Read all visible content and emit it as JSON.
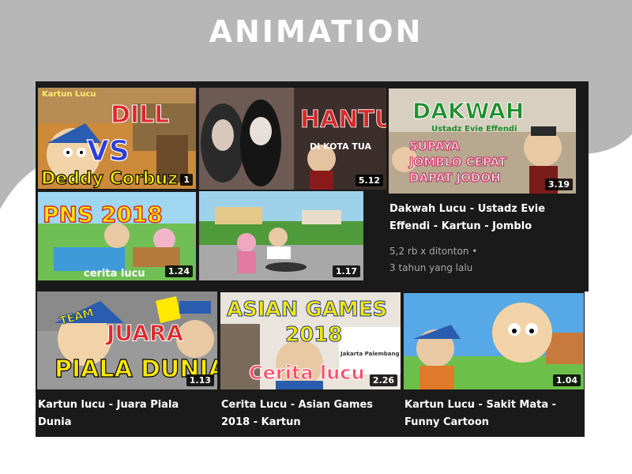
{
  "page": {
    "heading": "ANIMATION"
  },
  "colors": {
    "background_grey": "#b7b7b7",
    "panel": "#1a1a1a",
    "title_text": "#ffffff",
    "meta_text": "#a8a8a8"
  },
  "videos": [
    {
      "thumb_text": [
        "Kartun Lucu",
        "DILL",
        "VS",
        "Deddy Corbuz"
      ],
      "duration": "1"
    },
    {
      "thumb_text": [
        "HANTU",
        "DI KOTA TUA"
      ],
      "duration": "5.12"
    },
    {
      "thumb_text": [
        "DAKWAH",
        "Ustadz Evie Effendi",
        "SUPAYA",
        "JOMBLO CEPAT",
        "DAPAT JODOH"
      ],
      "duration": "3.19",
      "title_lines": [
        "Dakwah Lucu - Ustadz Evie",
        "Effendi - Kartun - Jomblo"
      ],
      "views": "5,2 rb x ditonton",
      "dot": "•",
      "age": "3 tahun yang lalu"
    },
    {
      "thumb_text": [
        "PNS 2018",
        "cerita lucu"
      ],
      "duration": "1.24"
    },
    {
      "thumb_text": [],
      "duration": "1.17"
    },
    {
      "thumb_text": [
        "TEAM",
        "JUARA",
        "PIALA DUNIA"
      ],
      "duration": "1.13",
      "title_lines": [
        "Kartun lucu - Juara Piala",
        "Dunia"
      ]
    },
    {
      "thumb_text": [
        "ASIAN GAMES",
        "2018",
        "Jakarta Palembang 2018",
        "Cerita lucu"
      ],
      "duration": "2.26",
      "title_lines": [
        "Cerita Lucu - Asian Games",
        "2018 - Kartun"
      ]
    },
    {
      "thumb_text": [],
      "duration": "1.04",
      "title_lines": [
        "Kartun Lucu - Sakit Mata -",
        "Funny Cartoon"
      ]
    }
  ]
}
